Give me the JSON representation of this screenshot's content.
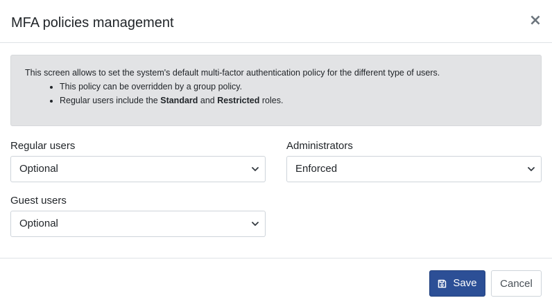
{
  "modal": {
    "title": "MFA policies management",
    "close_symbol": "×"
  },
  "info": {
    "intro": "This screen allows to set the system's default multi-factor authentication policy for the different type of users.",
    "bullet1": "This policy can be overridden by a group policy.",
    "bullet2": {
      "prefix": "Regular users include the ",
      "role1": "Standard",
      "middle": " and ",
      "role2": "Restricted",
      "suffix": " roles."
    }
  },
  "fields": {
    "regular_users": {
      "label": "Regular users",
      "value": "Optional"
    },
    "administrators": {
      "label": "Administrators",
      "value": "Enforced"
    },
    "guest_users": {
      "label": "Guest users",
      "value": "Optional"
    }
  },
  "footer": {
    "save_label": "Save",
    "save_icon": "floppy-disk-icon",
    "cancel_label": "Cancel"
  },
  "colors": {
    "primary": "#2c4f96",
    "info_bg": "#e2e3e5"
  }
}
